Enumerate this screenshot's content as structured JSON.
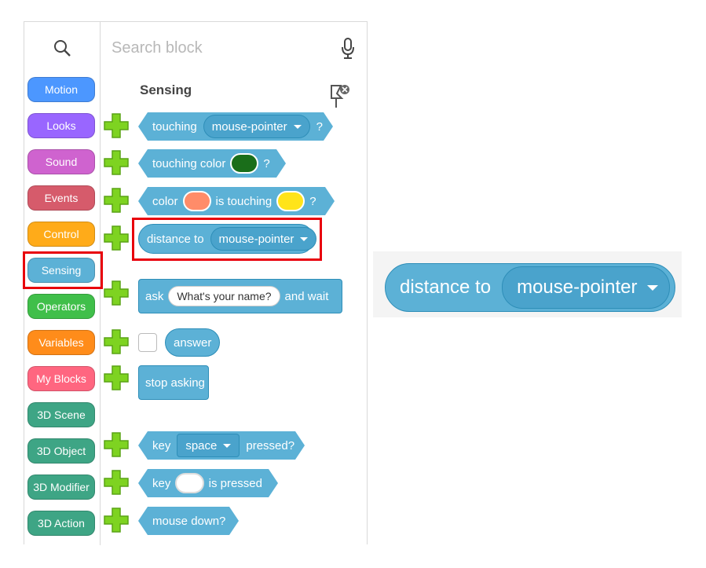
{
  "search": {
    "placeholder": "Search block"
  },
  "categories": [
    {
      "label": "Motion",
      "color": "#4c97ff"
    },
    {
      "label": "Looks",
      "color": "#9966ff"
    },
    {
      "label": "Sound",
      "color": "#cf63cf"
    },
    {
      "label": "Events",
      "color": "#d65b6b"
    },
    {
      "label": "Control",
      "color": "#ffab19"
    },
    {
      "label": "Sensing",
      "color": "#5cb1d6"
    },
    {
      "label": "Operators",
      "color": "#40bf4a"
    },
    {
      "label": "Variables",
      "color": "#ff8c1a"
    },
    {
      "label": "My Blocks",
      "color": "#ff6680"
    },
    {
      "label": "3D Scene",
      "color": "#3ea585"
    },
    {
      "label": "3D Object",
      "color": "#3ea585"
    },
    {
      "label": "3D Modifier",
      "color": "#3ea585"
    },
    {
      "label": "3D Action",
      "color": "#3ea585"
    }
  ],
  "section_title": "Sensing",
  "blocks": {
    "touching": {
      "word": "touching",
      "menu": "mouse-pointer",
      "q": "?"
    },
    "touching_color": {
      "word": "touching color",
      "swatch": "#1a6e1a",
      "q": "?"
    },
    "color_touching": {
      "word1": "color",
      "swatch1": "#ff8c69",
      "word2": "is touching",
      "swatch2": "#ffe41a",
      "q": "?"
    },
    "distance": {
      "word": "distance to",
      "menu": "mouse-pointer"
    },
    "ask": {
      "word1": "ask",
      "input": "What's your name?",
      "word2": "and wait"
    },
    "answer": {
      "word": "answer"
    },
    "stop_asking": {
      "word": "stop asking"
    },
    "key_pressed": {
      "word1": "key",
      "menu": "space",
      "word2": "pressed?"
    },
    "key_is_pressed": {
      "word1": "key",
      "word2": "is pressed"
    },
    "mouse_down": {
      "word": "mouse down?"
    }
  },
  "zoom": {
    "word": "distance to",
    "menu": "mouse-pointer"
  },
  "colors": {
    "highlight": "#e8000b",
    "sensing": "#5cb1d6",
    "plus": "#7ed321"
  }
}
